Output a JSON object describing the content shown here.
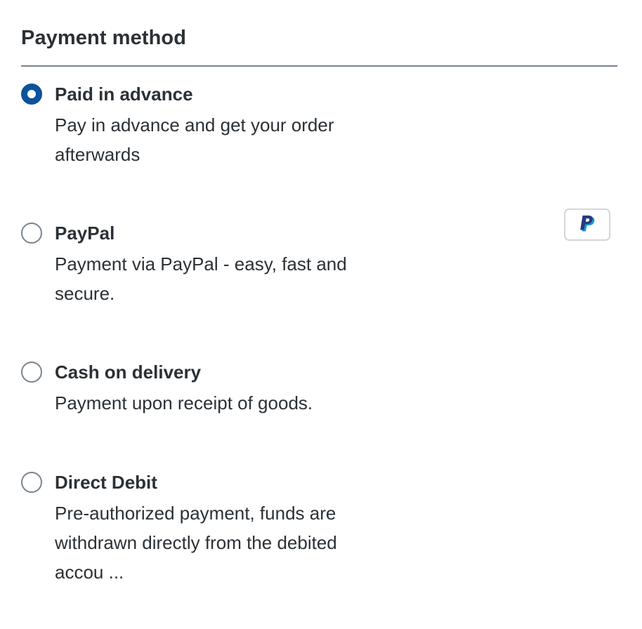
{
  "section": {
    "title": "Payment method"
  },
  "options": [
    {
      "label": "Paid in advance",
      "description": "Pay in advance and get your order\nafterwards",
      "selected": true
    },
    {
      "label": "PayPal",
      "description": "Payment via PayPal - easy, fast and\nsecure.",
      "selected": false,
      "logo_icon": "paypal-logo-icon"
    },
    {
      "label": "Cash on delivery",
      "description": "Payment upon receipt of goods.",
      "selected": false
    },
    {
      "label": "Direct Debit",
      "description": "Pre-authorized payment, funds are\nwithdrawn directly from the debited\naccou ...",
      "selected": false
    }
  ],
  "colors": {
    "text": "#2b3136",
    "radio_selected": "#0b539b",
    "radio_border": "#798490",
    "divider": "#798490",
    "paypal_dark": "#253b80",
    "paypal_light": "#179bd7"
  }
}
